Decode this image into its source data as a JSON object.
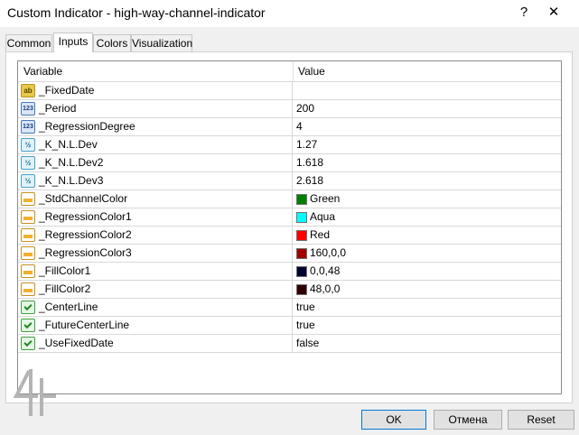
{
  "window": {
    "title": "Custom Indicator - high-way-channel-indicator",
    "help_label": "?",
    "close_label": "✕"
  },
  "tabs": [
    {
      "label": "Common",
      "active": false
    },
    {
      "label": "Inputs",
      "active": true
    },
    {
      "label": "Colors",
      "active": false
    },
    {
      "label": "Visualization",
      "active": false
    }
  ],
  "grid": {
    "columns": [
      "Variable",
      "Value"
    ],
    "rows": [
      {
        "icon": "string-ab-icon",
        "variable": "_FixedDate",
        "value": ""
      },
      {
        "icon": "integer-123-icon",
        "variable": "_Period",
        "value": "200"
      },
      {
        "icon": "integer-123-icon",
        "variable": "_RegressionDegree",
        "value": "4"
      },
      {
        "icon": "double-fraction-icon",
        "variable": "_K_N.L.Dev",
        "value": "1.27"
      },
      {
        "icon": "double-fraction-icon",
        "variable": "_K_N.L.Dev2",
        "value": "1.618"
      },
      {
        "icon": "double-fraction-icon",
        "variable": "_K_N.L.Dev3",
        "value": "2.618"
      },
      {
        "icon": "color-icon",
        "variable": "_StdChannelColor",
        "value": "Green",
        "swatch": "#008000"
      },
      {
        "icon": "color-icon",
        "variable": "_RegressionColor1",
        "value": "Aqua",
        "swatch": "#00ffff"
      },
      {
        "icon": "color-icon",
        "variable": "_RegressionColor2",
        "value": "Red",
        "swatch": "#ff0000"
      },
      {
        "icon": "color-icon",
        "variable": "_RegressionColor3",
        "value": "160,0,0",
        "swatch": "#a00000"
      },
      {
        "icon": "color-icon",
        "variable": "_FillColor1",
        "value": "0,0,48",
        "swatch": "#000030"
      },
      {
        "icon": "color-icon",
        "variable": "_FillColor2",
        "value": "48,0,0",
        "swatch": "#300000"
      },
      {
        "icon": "boolean-icon",
        "variable": "_CenterLine",
        "value": "true"
      },
      {
        "icon": "boolean-icon",
        "variable": "_FutureCenterLine",
        "value": "true"
      },
      {
        "icon": "boolean-icon",
        "variable": "_UseFixedDate",
        "value": "false"
      }
    ]
  },
  "buttons": {
    "ok": "OK",
    "cancel": "Отмена",
    "reset": "Reset"
  },
  "colors": {
    "ok_border": "#0078d7",
    "grid_border": "#8c8c8c"
  }
}
